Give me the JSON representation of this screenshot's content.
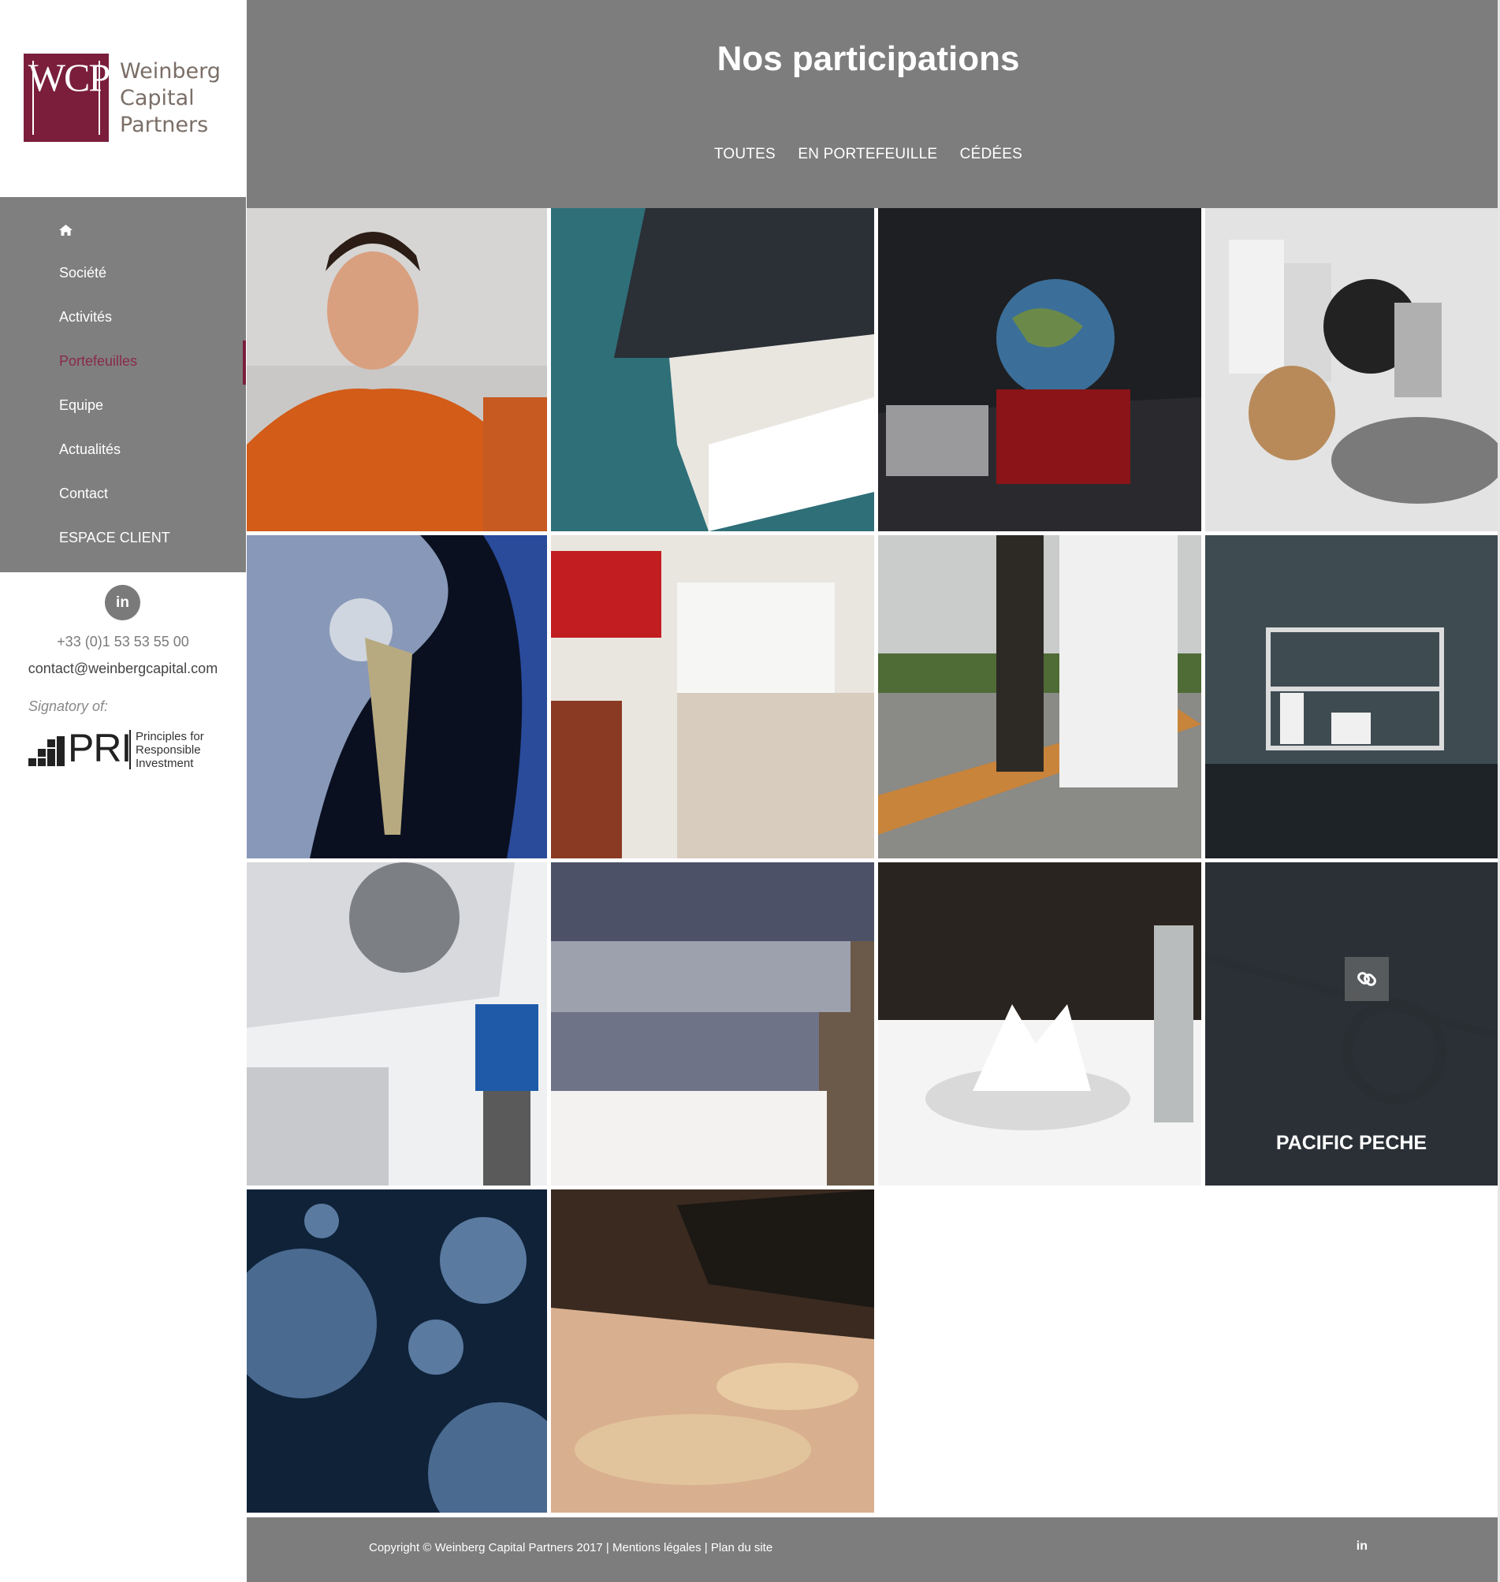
{
  "brand": {
    "logo_mark": "WCP",
    "logo_line1": "Weinberg",
    "logo_line2": "Capital",
    "logo_line3": "Partners",
    "accent_color": "#7a1e3c"
  },
  "nav": {
    "home_icon": "home-icon",
    "items": [
      {
        "label": "Société"
      },
      {
        "label": "Activités"
      },
      {
        "label": "Portefeuilles",
        "active": true
      },
      {
        "label": "Equipe"
      },
      {
        "label": "Actualités"
      },
      {
        "label": "Contact"
      },
      {
        "label": "ESPACE CLIENT"
      }
    ]
  },
  "contact": {
    "linkedin_icon": "in",
    "phone": "+33 (0)1 53 53 55 00",
    "email": "contact@weinbergcapital.com",
    "signatory": "Signatory of:",
    "pri": {
      "acronym": "PRI",
      "line1": "Principles for",
      "line2": "Responsible",
      "line3": "Investment"
    }
  },
  "header": {
    "title": "Nos participations",
    "filters": [
      "TOUTES",
      "EN PORTEFEUILLE",
      "CÉDÉES"
    ]
  },
  "portfolio": {
    "hover_label": "PACIFIC PECHE",
    "hover_icon": "link-icon",
    "tiles": [
      {
        "name": "tile-craftsman"
      },
      {
        "name": "tile-sailboat"
      },
      {
        "name": "tile-chess-globe"
      },
      {
        "name": "tile-auto-parts"
      },
      {
        "name": "tile-hip-implant"
      },
      {
        "name": "tile-renovation-tools"
      },
      {
        "name": "tile-roofing-workers"
      },
      {
        "name": "tile-shelving"
      },
      {
        "name": "tile-hvac-technician"
      },
      {
        "name": "tile-knitwear"
      },
      {
        "name": "tile-table-setting"
      },
      {
        "name": "tile-pacific-peche"
      },
      {
        "name": "tile-virus"
      },
      {
        "name": "tile-bakery"
      }
    ]
  },
  "footer": {
    "copyright": "Copyright © Weinberg Capital Partners 2017",
    "separator": " | ",
    "legal": "Mentions légales",
    "sitemap": "Plan du site",
    "linkedin_icon": "in"
  }
}
